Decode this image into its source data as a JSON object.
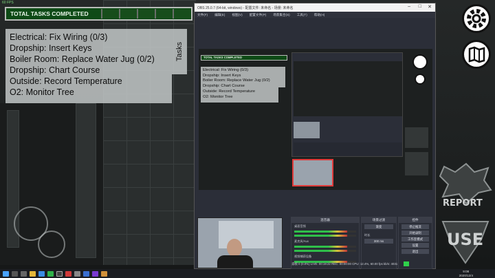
{
  "hud": {
    "fps_label": "60 FPS",
    "total_tasks_label": "TOTAL TASKS COMPLETED",
    "tasks_tab_label": "Tasks",
    "task_list": [
      "Electrical: Fix Wiring (0/3)",
      "Dropship: Insert Keys",
      "Boiler Room: Replace Water Jug (0/2)",
      "Dropship: Chart Course",
      "Outside: Record Temperature",
      "O2: Monitor Tree"
    ],
    "settings_icon": "gear-icon",
    "map_icon": "map-icon",
    "report_label": "REPORT",
    "use_label": "USE"
  },
  "obs": {
    "title": "OBS 25.0.7 (64-bit, windows) - 配置文件: 未命名 - 场景: 未命名",
    "menu": [
      "文件(F)",
      "编辑(E)",
      "视图(V)",
      "配置文件(P)",
      "场景集合(S)",
      "工具(T)",
      "帮助(H)"
    ],
    "preview_total_label": "TOTAL TASKS COMPLETED",
    "preview_tasks_tab": "Tasks",
    "docks": {
      "mixer_title": "混音器",
      "transitions_title": "场景过渡",
      "controls_title": "控件",
      "mixer_track1": "桌面音频",
      "mixer_track2": "麦克风/Aux",
      "mixer_track3": "视频捕获设备",
      "transition_type": "渐变",
      "duration_label": "时长",
      "duration_value": "300 ms",
      "controls": [
        "停止推流",
        "开始录制",
        "工作室模式",
        "设置",
        "退出"
      ]
    },
    "status_bar": "丢帧 0 (0.0%)   LIVE: 00:19:22   REC: 00:00:00   CPU: 12.4%, 60.00 fps   kb/s: 4031"
  },
  "taskbar": {
    "time": "9:08",
    "date": "2020/12/4"
  },
  "colors": {
    "task_bar_green": "#0e4a16",
    "task_panel_bg": "#c8cdcd",
    "obs_bg": "#2b2e38",
    "rec_indicator": "#2fd04a"
  }
}
